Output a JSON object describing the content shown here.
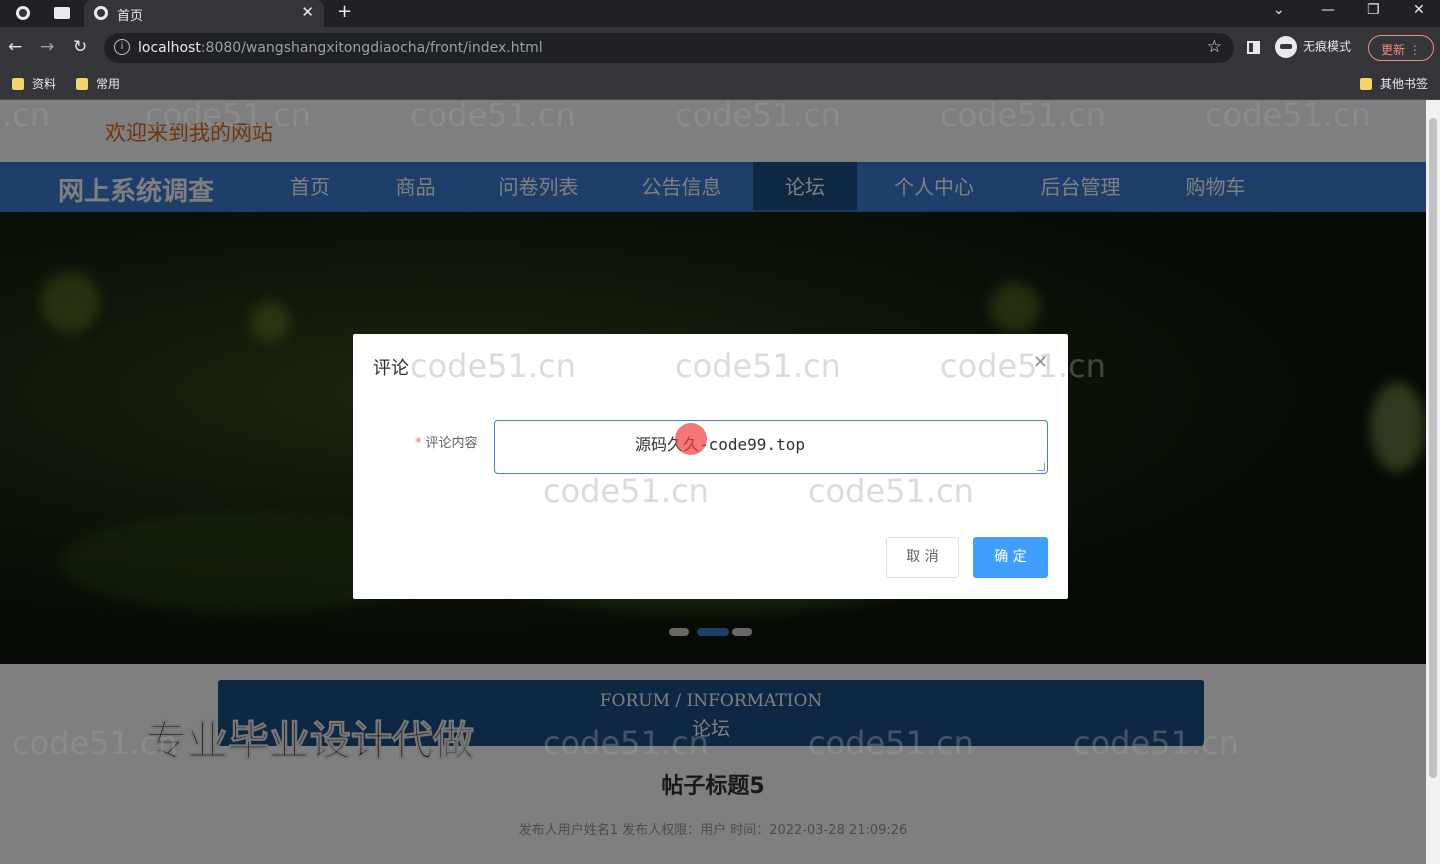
{
  "browser": {
    "tab_title": "首页",
    "url_host": "localhost",
    "url_path": ":8080/wangshangxitongdiaocha/front/index.html",
    "incognito_label": "无痕模式",
    "update_label": "更新",
    "bookmarks": [
      "资料",
      "常用"
    ],
    "other_bookmarks": "其他书签"
  },
  "site": {
    "welcome": "欢迎来到我的网站",
    "title": "网上系统调查",
    "nav": [
      "首页",
      "商品",
      "问卷列表",
      "公告信息",
      "论坛",
      "个人中心",
      "后台管理",
      "购物车"
    ],
    "active_nav": "论坛"
  },
  "section": {
    "en": "FORUM / INFORMATION",
    "cn": "论坛"
  },
  "post": {
    "title": "帖子标题5",
    "meta": "发布人用户姓名1   发布人权限：用户   时间：2022-03-28 21:09:26"
  },
  "promo": "专业毕业设计代做",
  "dialog": {
    "title": "评论",
    "label": "评论内容",
    "value": "源码久久-code99.top",
    "cancel": "取 消",
    "confirm": "确 定"
  },
  "watermark": "code51.cn",
  "colors": {
    "nav_bg": "#3f7fd6",
    "nav_active": "#1c4f86",
    "primary_button": "#409eff",
    "welcome_text": "#e06a1a"
  }
}
